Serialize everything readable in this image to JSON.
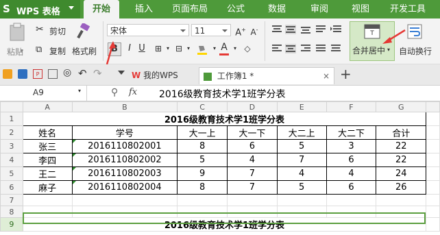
{
  "app": {
    "name": "WPS 表格"
  },
  "menu_tabs": [
    "开始",
    "插入",
    "页面布局",
    "公式",
    "数据",
    "审阅",
    "视图",
    "开发工具"
  ],
  "ribbon": {
    "paste": "粘贴",
    "cut": "剪切",
    "copy": "复制",
    "format_painter": "格式刷",
    "font_name": "宋体",
    "font_size": "11",
    "bold": "B",
    "italic": "I",
    "underline": "U",
    "merge_center": "合并居中",
    "wrap_text": "自动换行"
  },
  "doc_tabs": [
    "我的WPS",
    "工作簿1 *"
  ],
  "formula_bar": {
    "cell_ref": "A9",
    "fx": "fx",
    "content": "2016级教育技术学1班学分表"
  },
  "columns": [
    "A",
    "B",
    "C",
    "D",
    "E",
    "F",
    "G"
  ],
  "rows": [
    "1",
    "2",
    "3",
    "4",
    "5",
    "6",
    "7",
    "8",
    "9"
  ],
  "sheet": {
    "title": "2016级教育技术学1班学分表",
    "headers": [
      "姓名",
      "学号",
      "大一上",
      "大一下",
      "大二上",
      "大二下",
      "合计"
    ],
    "data": [
      [
        "张三",
        "2016110802001",
        "8",
        "6",
        "5",
        "3",
        "22"
      ],
      [
        "李四",
        "2016110802002",
        "5",
        "4",
        "7",
        "6",
        "22"
      ],
      [
        "王二",
        "2016110802003",
        "9",
        "7",
        "4",
        "4",
        "24"
      ],
      [
        "麻子",
        "2016110802004",
        "8",
        "7",
        "5",
        "6",
        "26"
      ]
    ],
    "row9": "2016级教育技术学1班学分表"
  },
  "colors": {
    "menubar": "#4e9a3a",
    "selection": "#5a9e3e",
    "arrow": "#e53935"
  }
}
